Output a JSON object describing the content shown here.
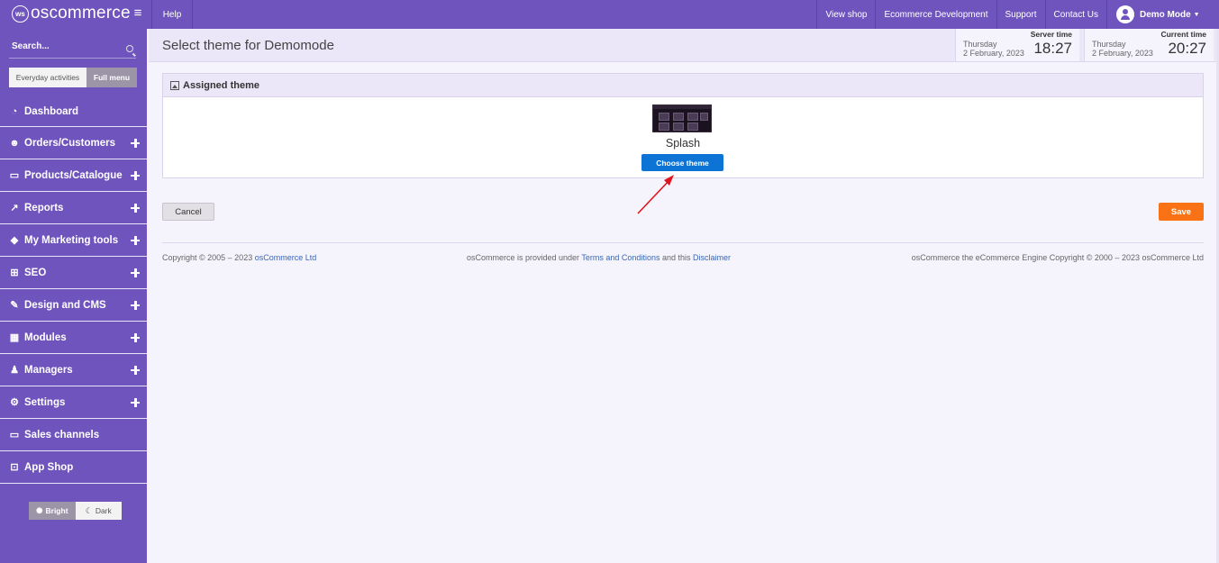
{
  "brand": {
    "logo_mark": "ws",
    "name": "oscommerce"
  },
  "topbar": {
    "help": "Help",
    "links": [
      "View shop",
      "Ecommerce Development",
      "Support",
      "Contact Us"
    ],
    "user": "Demo Mode"
  },
  "sidebar": {
    "search_label": "Search...",
    "menu_toggle": {
      "everyday": "Everyday activities",
      "full": "Full menu"
    },
    "items": [
      {
        "label": "Dashboard",
        "icon": "dashboard-icon"
      },
      {
        "label": "Orders/Customers",
        "icon": "users-icon"
      },
      {
        "label": "Products/Catalogue",
        "icon": "folder-icon"
      },
      {
        "label": "Reports",
        "icon": "chart-icon"
      },
      {
        "label": "My Marketing tools",
        "icon": "tag-icon"
      },
      {
        "label": "SEO",
        "icon": "sitemap-icon"
      },
      {
        "label": "Design and CMS",
        "icon": "brush-icon"
      },
      {
        "label": "Modules",
        "icon": "puzzle-icon"
      },
      {
        "label": "Managers",
        "icon": "person-icon"
      },
      {
        "label": "Settings",
        "icon": "gears-icon"
      },
      {
        "label": "Sales channels",
        "icon": "monitor-icon"
      },
      {
        "label": "App Shop",
        "icon": "cart-icon"
      }
    ],
    "theme_switch": {
      "bright": "Bright",
      "dark": "Dark"
    }
  },
  "header": {
    "title": "Select theme for Demomode",
    "server_time": {
      "label": "Server time",
      "day": "Thursday",
      "date": "2 February, 2023",
      "time": "18:27"
    },
    "current_time": {
      "label": "Current time",
      "day": "Thursday",
      "date": "2 February, 2023",
      "time": "20:27"
    }
  },
  "panel": {
    "heading": "Assigned theme",
    "theme_name": "Splash",
    "choose_button": "Choose theme"
  },
  "actions": {
    "cancel": "Cancel",
    "save": "Save"
  },
  "footer": {
    "left_text": "Copyright © 2005 – 2023 ",
    "left_link": "osCommerce Ltd",
    "center_text_1": "osCommerce is provided under ",
    "center_link_1": "Terms and Conditions",
    "center_text_2": " and this ",
    "center_link_2": "Disclaimer",
    "right_text": "osCommerce the eCommerce Engine Copyright © 2000 – 2023 osCommerce Ltd"
  },
  "colors": {
    "brand": "#6f54be",
    "choose_button": "#0d74d6",
    "save_button": "#f97316",
    "arrow": "#e0141e"
  }
}
